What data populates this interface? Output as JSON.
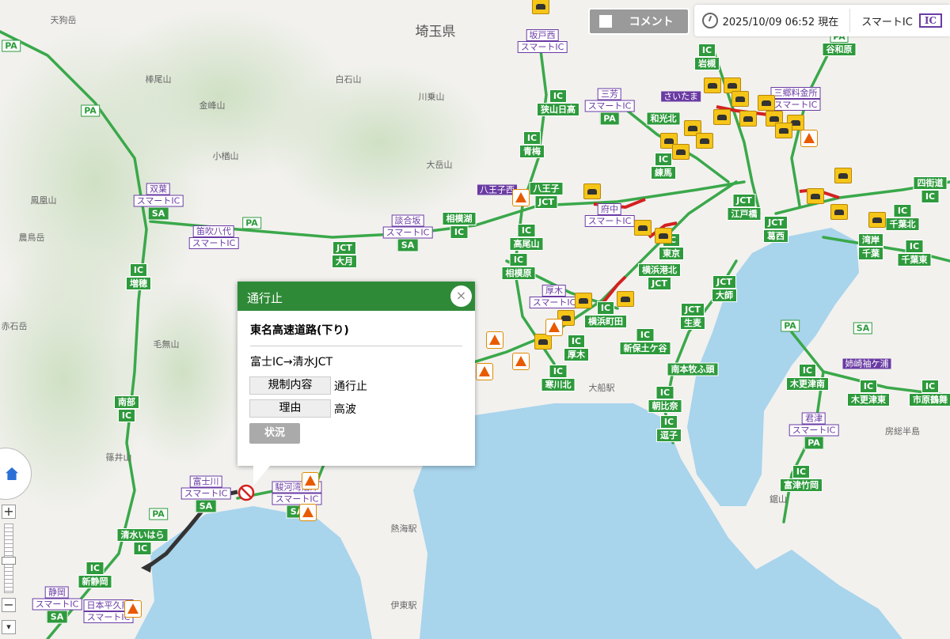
{
  "toolbar": {
    "comment_label": "コメント",
    "datetime": "2025/10/09 06:52 現在",
    "smart_ic_label": "スマートIC",
    "smart_ic_badge": "IC"
  },
  "popup": {
    "title": "通行止",
    "close": "×",
    "road": "東名高速道路(下り)",
    "section": "富士IC→清水JCT",
    "rows": [
      {
        "label": "規制内容",
        "value": "通行止"
      },
      {
        "label": "理由",
        "value": "高波"
      }
    ],
    "status_button": "状況"
  },
  "zoom_controls": {
    "zoom_in": "+",
    "zoom_out": "−",
    "more": "▾"
  },
  "colors": {
    "road": "#2e9a3c",
    "closure_section": "#333333",
    "jam_arrow": "#d42020",
    "sea": "#a8d4ec",
    "smart_ic": "#6a3ba3",
    "popup_header": "#2f8a38"
  },
  "places": [
    "埼玉県",
    "天狗岳",
    "棒尾山",
    "白石山",
    "川乗山",
    "金峰山",
    "小楢山",
    "大岳山",
    "鳳凰山",
    "農鳥岳",
    "赤石岳",
    "毛無山",
    "篠井山",
    "鋸山",
    "房総半島",
    "熱海駅",
    "伊東駅",
    "大船駅"
  ],
  "signs": [
    {
      "kind": "smart",
      "name": "坂戸西",
      "sub": "スマートIC"
    },
    {
      "kind": "ic",
      "top": "IC",
      "name": "岩槻"
    },
    {
      "kind": "pa",
      "top": "PA",
      "name": "谷和原"
    },
    {
      "kind": "pa",
      "top": "PA"
    },
    {
      "kind": "pa",
      "top": "PA"
    },
    {
      "kind": "ic",
      "top": "IC",
      "name": "狭山日高"
    },
    {
      "kind": "smart",
      "name": "三芳",
      "sub": "スマートIC",
      "tag": "PA"
    },
    {
      "kind": "ic",
      "top": "IC",
      "name": "青梅"
    },
    {
      "kind": "purple",
      "name": "八王子西"
    },
    {
      "kind": "ic",
      "top": "八王子",
      "name": "JCT"
    },
    {
      "kind": "smart",
      "name": "双葉",
      "sub": "スマートIC",
      "tag": "SA"
    },
    {
      "kind": "pa",
      "top": "PA"
    },
    {
      "kind": "smart",
      "name": "笛吹八代",
      "sub": "スマートIC"
    },
    {
      "kind": "smart",
      "name": "談合坂",
      "sub": "スマートIC",
      "tag": "SA"
    },
    {
      "kind": "ic",
      "top": "相模湖",
      "name": "IC"
    },
    {
      "kind": "ic",
      "top": "JCT",
      "name": "大月"
    },
    {
      "kind": "ic",
      "top": "IC",
      "name": "高尾山"
    },
    {
      "kind": "ic",
      "top": "IC",
      "name": "相模原"
    },
    {
      "kind": "ic",
      "top": "IC",
      "name": "増穂"
    },
    {
      "kind": "ic",
      "top": "JCT",
      "name": "江戸橋"
    },
    {
      "kind": "ic",
      "top": "JCT",
      "name": "葛西"
    },
    {
      "kind": "ic",
      "top": "四街道",
      "name": "IC"
    },
    {
      "kind": "ic",
      "top": "IC",
      "name": "千葉北"
    },
    {
      "kind": "ic",
      "top": "IC",
      "name": "千葉東"
    },
    {
      "kind": "ic",
      "top": "横浜港北",
      "name": "JCT"
    },
    {
      "kind": "ic",
      "top": "JCT",
      "name": "大師"
    },
    {
      "kind": "ic",
      "top": "JCT",
      "name": "生麦"
    },
    {
      "kind": "smart",
      "name": "厚木",
      "sub": "スマートIC"
    },
    {
      "kind": "ic",
      "top": "IC",
      "name": "新保土ケ谷"
    },
    {
      "kind": "ic",
      "top": "IC",
      "name": "厚木"
    },
    {
      "kind": "ic",
      "top": "IC",
      "name": "寒川北"
    },
    {
      "kind": "ic",
      "top": "南本牧ふ頭"
    },
    {
      "kind": "ic",
      "top": "IC",
      "name": "朝比奈"
    },
    {
      "kind": "ic",
      "top": "IC",
      "name": "逗子"
    },
    {
      "kind": "pa",
      "top": "PA"
    },
    {
      "kind": "pa",
      "top": "SA"
    },
    {
      "kind": "purple",
      "name": "姉崎袖ケ浦"
    },
    {
      "kind": "ic",
      "top": "IC",
      "name": "木更津南"
    },
    {
      "kind": "ic",
      "top": "IC",
      "name": "木更津東"
    },
    {
      "kind": "ic",
      "top": "IC",
      "name": "市原鶴舞"
    },
    {
      "kind": "smart",
      "name": "君津",
      "sub": "スマートIC",
      "tag": "PA"
    },
    {
      "kind": "ic",
      "top": "IC",
      "name": "富津竹岡"
    },
    {
      "kind": "ic",
      "top": "南部",
      "name": "IC"
    },
    {
      "kind": "smart",
      "name": "富士川",
      "sub": "スマートIC",
      "tag": "SA"
    },
    {
      "kind": "smart",
      "name": "駿河湾沼津",
      "sub": "スマートIC",
      "tag": "SA"
    },
    {
      "kind": "pa",
      "top": "PA"
    },
    {
      "kind": "ic",
      "top": "清水いはら",
      "name": "IC"
    },
    {
      "kind": "ic",
      "top": "IC",
      "name": "新静岡"
    },
    {
      "kind": "smart",
      "name": "静岡",
      "sub": "スマートIC",
      "tag": "SA"
    },
    {
      "kind": "smart",
      "name": "日本平久能",
      "sub": "スマートIC"
    },
    {
      "kind": "ic",
      "top": "IC",
      "name": "練馬"
    },
    {
      "kind": "ic",
      "top": "IC",
      "name": "東京"
    },
    {
      "kind": "ic",
      "top": "IC",
      "name": "横浜町田"
    },
    {
      "kind": "smart",
      "name": "府中",
      "sub": "スマートIC"
    },
    {
      "kind": "purple",
      "name": "さいたま"
    },
    {
      "kind": "ic",
      "top": "和光北"
    },
    {
      "kind": "smart",
      "name": "三郷料金所",
      "sub": "スマートIC"
    },
    {
      "kind": "ic",
      "top": "湾岸",
      "name": "千葉"
    }
  ]
}
